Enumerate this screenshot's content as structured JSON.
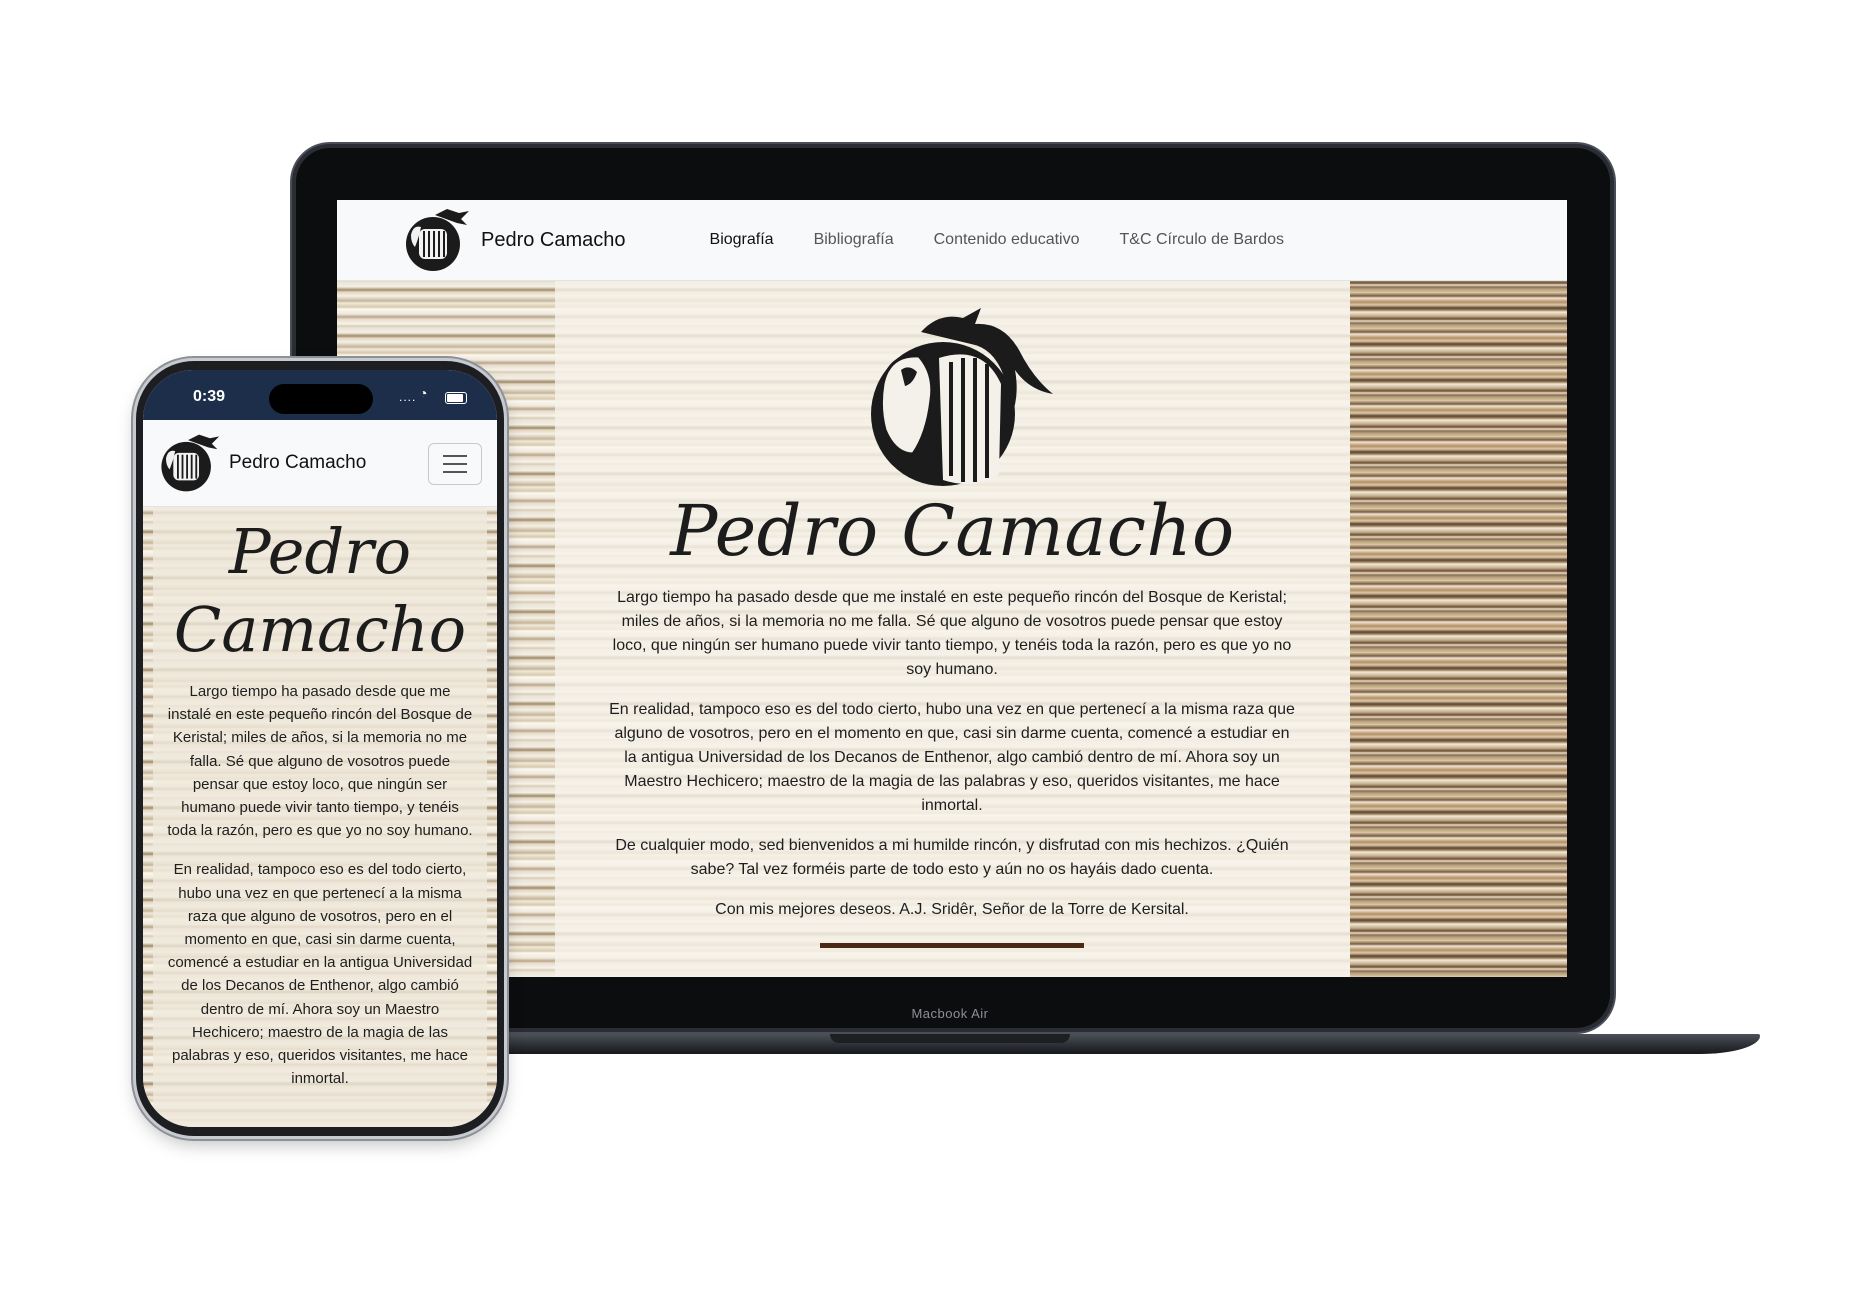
{
  "site": {
    "brand_name": "Pedro Camacho",
    "nav": [
      {
        "label": "Biografía",
        "active": true
      },
      {
        "label": "Bibliografía",
        "active": false
      },
      {
        "label": "Contenido educativo",
        "active": false
      },
      {
        "label": "T&C Círculo de Bardos",
        "active": false
      }
    ],
    "hero_title": "Pedro Camacho",
    "hero_title_line1": "Pedro",
    "hero_title_line2": "Camacho",
    "paragraphs": [
      "Largo tiempo ha pasado desde que me instalé en este pequeño rincón del Bosque de Keristal; miles de años, si la memoria no me falla. Sé que alguno de vosotros puede pensar que estoy loco, que ningún ser humano puede vivir tanto tiempo, y tenéis toda la razón, pero es que yo no soy humano.",
      "En realidad, tampoco eso es del todo cierto, hubo una vez en que pertenecí a la misma raza que alguno de vosotros, pero en el momento en que, casi sin darme cuenta, comencé a estudiar en la antigua Universidad de los Decanos de Enthenor, algo cambió dentro de mí. Ahora soy un Maestro Hechicero; maestro de la magia de las palabras y eso, queridos visitantes, me hace inmortal.",
      "De cualquier modo, sed bienvenidos a mi humilde rincón, y disfrutad con mis hechizos. ¿Quién sabe? Tal vez forméis parte de todo esto y aún no os hayáis dado cuenta.",
      "Con mis mejores deseos. A.J. Sridêr, Señor de la Torre de Kersital."
    ],
    "logo_icon": "dragon-harp-logo-icon",
    "accent_color": "#4a2a14"
  },
  "laptop": {
    "model_label": "Macbook Air"
  },
  "phone": {
    "status_time": "0:39",
    "signal_text": "....",
    "menu_icon": "hamburger-menu-icon"
  }
}
